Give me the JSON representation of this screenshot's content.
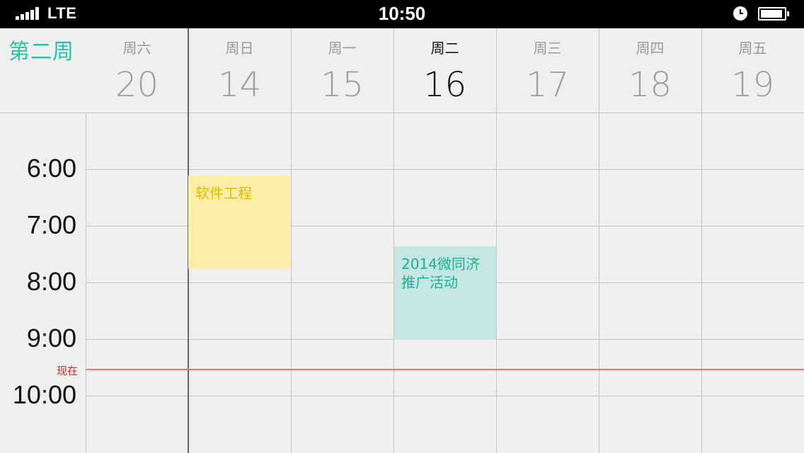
{
  "status_bar": {
    "carrier": "LTE",
    "time": "10:50",
    "signal_bars": 5,
    "battery_level": 0.95,
    "icons": [
      "signal-icon",
      "alarm-icon",
      "battery-icon"
    ]
  },
  "header": {
    "week_label": "第二周",
    "days": [
      {
        "name": "周六",
        "date": "20",
        "today": false
      },
      {
        "name": "周日",
        "date": "14",
        "today": false
      },
      {
        "name": "周一",
        "date": "15",
        "today": false
      },
      {
        "name": "周二",
        "date": "16",
        "today": true
      },
      {
        "name": "周三",
        "date": "17",
        "today": false
      },
      {
        "name": "周四",
        "date": "18",
        "today": false
      },
      {
        "name": "周五",
        "date": "19",
        "today": false
      }
    ]
  },
  "time_labels": [
    "6:00",
    "7:00",
    "8:00",
    "9:00",
    "10:00"
  ],
  "now_label": "现在",
  "events": [
    {
      "title": "软件工程",
      "day": "周日",
      "start": "6:06",
      "end": "7:48"
    },
    {
      "title": "2014微同济推广活动",
      "day": "周二",
      "start": "7:36",
      "end": "9:00"
    }
  ],
  "colors": {
    "accent": "#2bbfa8",
    "now_line": "#f0756f",
    "now_label": "#e22020",
    "event_yellow_bg": "#fdeea7",
    "event_yellow_text": "#e5b800",
    "event_teal_bg": "#c4e6e3",
    "event_teal_text": "#1fae98"
  }
}
